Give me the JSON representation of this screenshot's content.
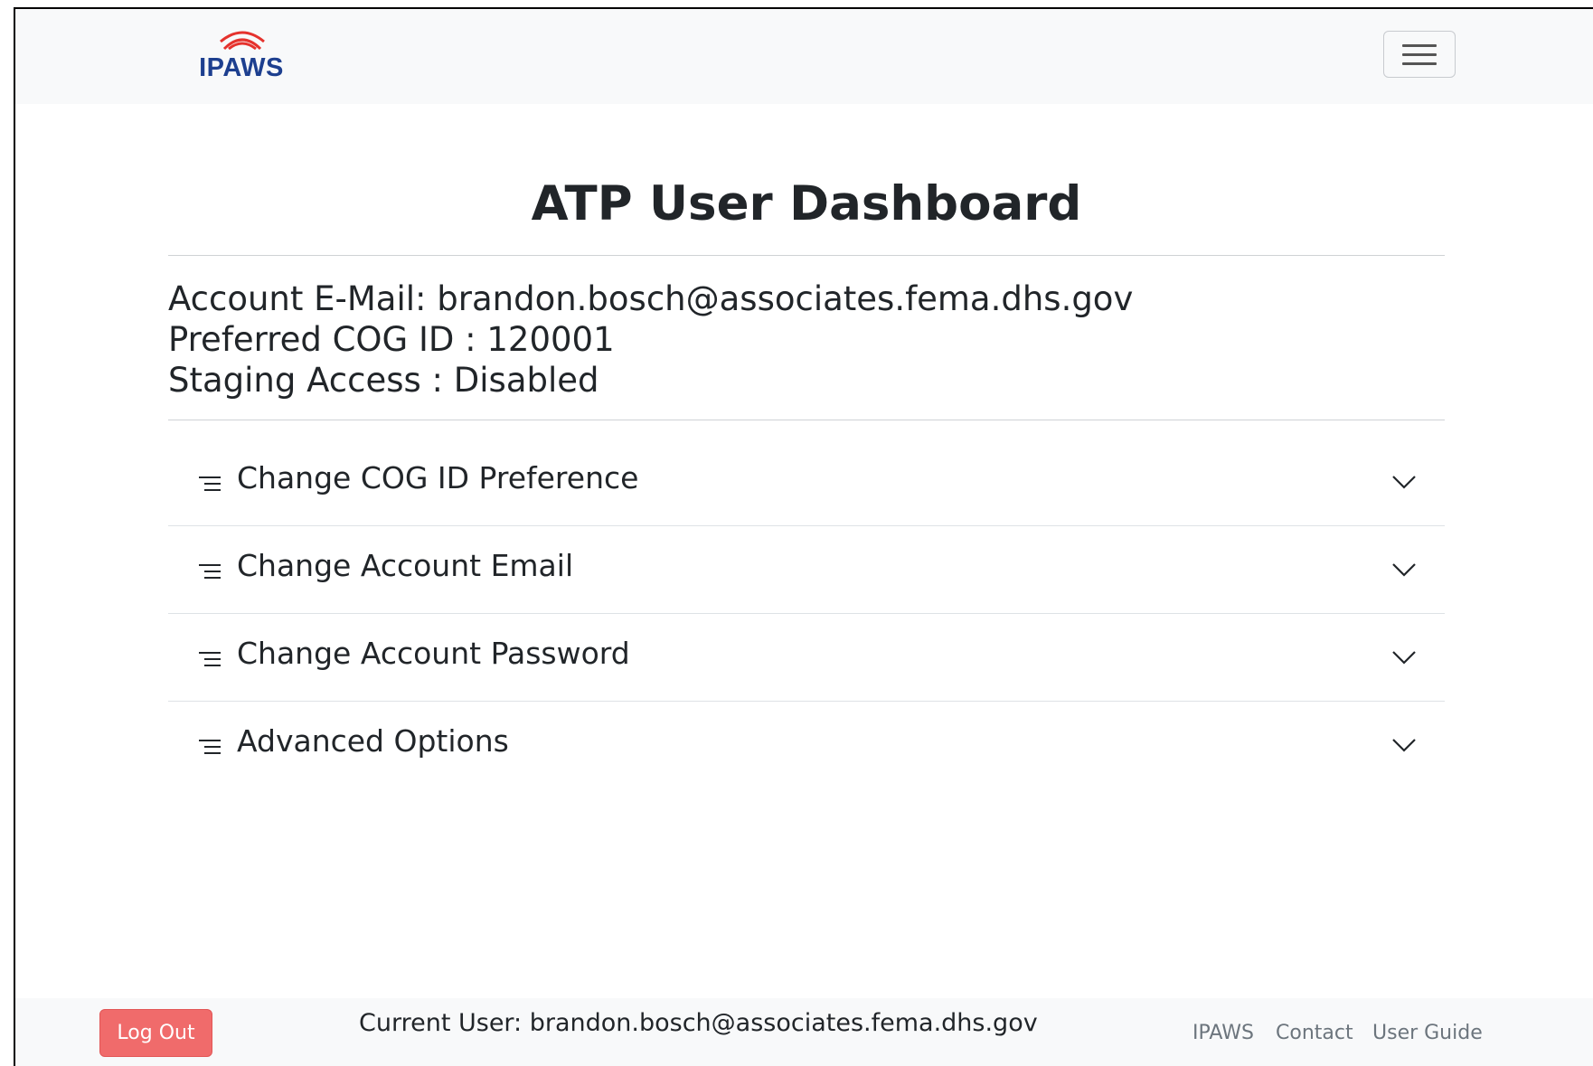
{
  "navbar": {
    "logo_text": "IPAWS",
    "logo_icon": "signal-waves-icon",
    "menu_icon": "hamburger-icon"
  },
  "main": {
    "title": "ATP User Dashboard",
    "account_email_line": "Account E-Mail: brandon.bosch@associates.fema.dhs.gov",
    "preferred_cog_line": "Preferred COG ID : 120001",
    "staging_access_line": "Staging Access : Disabled",
    "accordion": [
      {
        "label": "Change COG ID Preference",
        "icon": "list-icon",
        "toggle_icon": "chevron-down-icon"
      },
      {
        "label": "Change Account Email",
        "icon": "list-icon",
        "toggle_icon": "chevron-down-icon"
      },
      {
        "label": "Change Account Password",
        "icon": "list-icon",
        "toggle_icon": "chevron-down-icon"
      },
      {
        "label": "Advanced Options",
        "icon": "list-icon",
        "toggle_icon": "chevron-down-icon"
      }
    ]
  },
  "footer": {
    "logout_label": "Log Out",
    "current_user": "Current User: brandon.bosch@associates.fema.dhs.gov",
    "links": [
      "IPAWS",
      "Contact",
      "User Guide"
    ]
  },
  "colors": {
    "navbar_bg": "#f8f9fa",
    "logo_blue": "#1d3f8f",
    "logo_red": "#e5322d",
    "logout_bg": "#f06b6b",
    "link_gray": "#6c757d"
  }
}
